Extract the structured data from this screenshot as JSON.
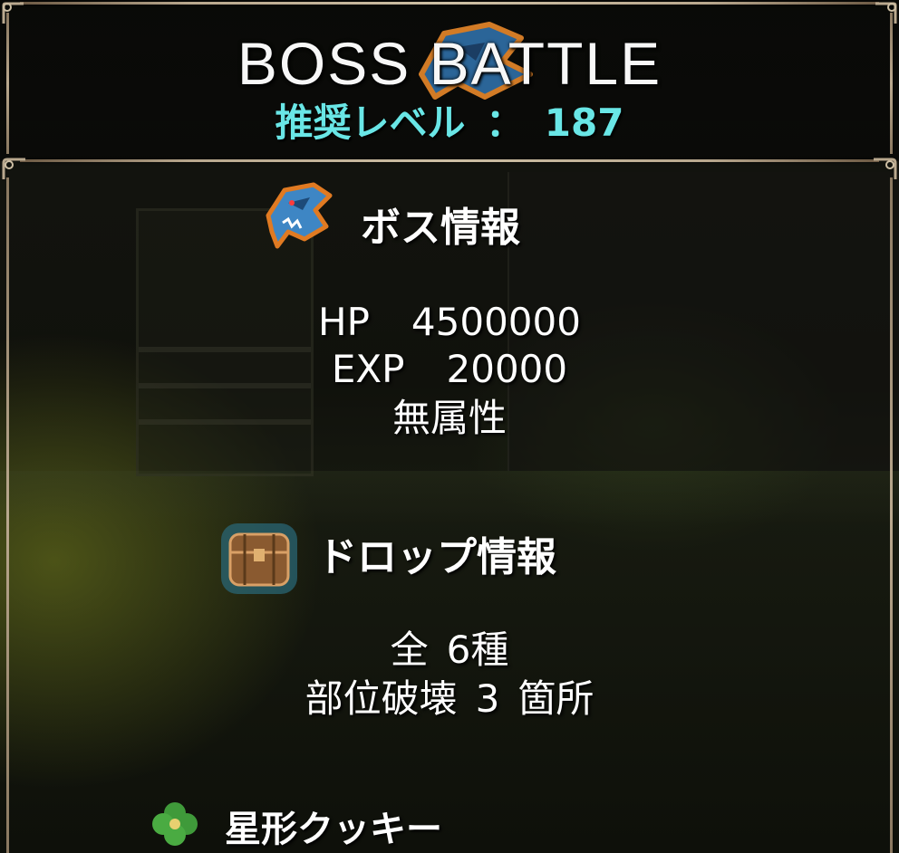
{
  "header": {
    "title": "BOSS BATTLE",
    "recommended_level_label": "推奨レベル",
    "separator": "：",
    "recommended_level_value": "187"
  },
  "boss_info": {
    "heading": "ボス情報",
    "icon": "shark-boss-icon",
    "hp_label": "HP",
    "hp_value": "4500000",
    "exp_label": "EXP",
    "exp_value": "20000",
    "attribute": "無属性"
  },
  "drop_info": {
    "heading": "ドロップ情報",
    "icon": "treasure-chest-icon",
    "total_prefix": "全",
    "total_value": "6種",
    "parts_label": "部位破壊",
    "parts_value": "3",
    "parts_unit": "箇所"
  },
  "drop_items": [
    {
      "name": "星形クッキー",
      "icon": "clover-cookie-icon"
    }
  ],
  "colors": {
    "level_text": "#69e6e6",
    "frame": "#b9a88e",
    "text": "#ffffff"
  }
}
